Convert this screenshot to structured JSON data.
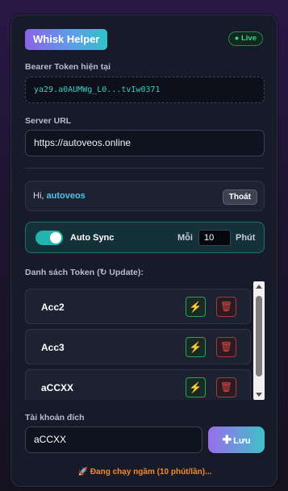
{
  "app": {
    "title": "Whisk Helper",
    "live_badge": "● Live"
  },
  "bearer": {
    "label": "Bearer Token hiện tại",
    "value": "ya29.a0AUMWg_L0...tvIw0371"
  },
  "server": {
    "label": "Server URL",
    "value": "https://autoveos.online"
  },
  "user": {
    "greeting": "Hi, ",
    "name": "autoveos",
    "logout_label": "Thoát"
  },
  "sync": {
    "label": "Auto Sync",
    "enabled": true,
    "every_label": "Mỗi",
    "interval": "10",
    "unit_label": "Phút"
  },
  "token_list": {
    "label": "Danh sách Token (↻ Update):",
    "rows": [
      {
        "name": "Acc2",
        "action_icon": "bolt-icon",
        "delete_icon": "trash-icon"
      },
      {
        "name": "Acc3",
        "action_icon": "bolt-icon",
        "delete_icon": "trash-icon"
      },
      {
        "name": "aCCXX",
        "action_icon": "bolt-icon",
        "delete_icon": "trash-icon"
      }
    ]
  },
  "target_account": {
    "label": "Tài khoản đích",
    "value": "aCCXX",
    "save_label": "Lưu",
    "save_icon": "plus-icon"
  },
  "status": {
    "text": "🚀 Đang chạy ngầm (10 phút/lần)..."
  },
  "colors": {
    "accent_teal": "#24b3ae",
    "accent_purple": "#9b6cec",
    "live_green": "#3fd08a",
    "status_orange": "#f08a2c",
    "danger_red": "#e04848"
  }
}
